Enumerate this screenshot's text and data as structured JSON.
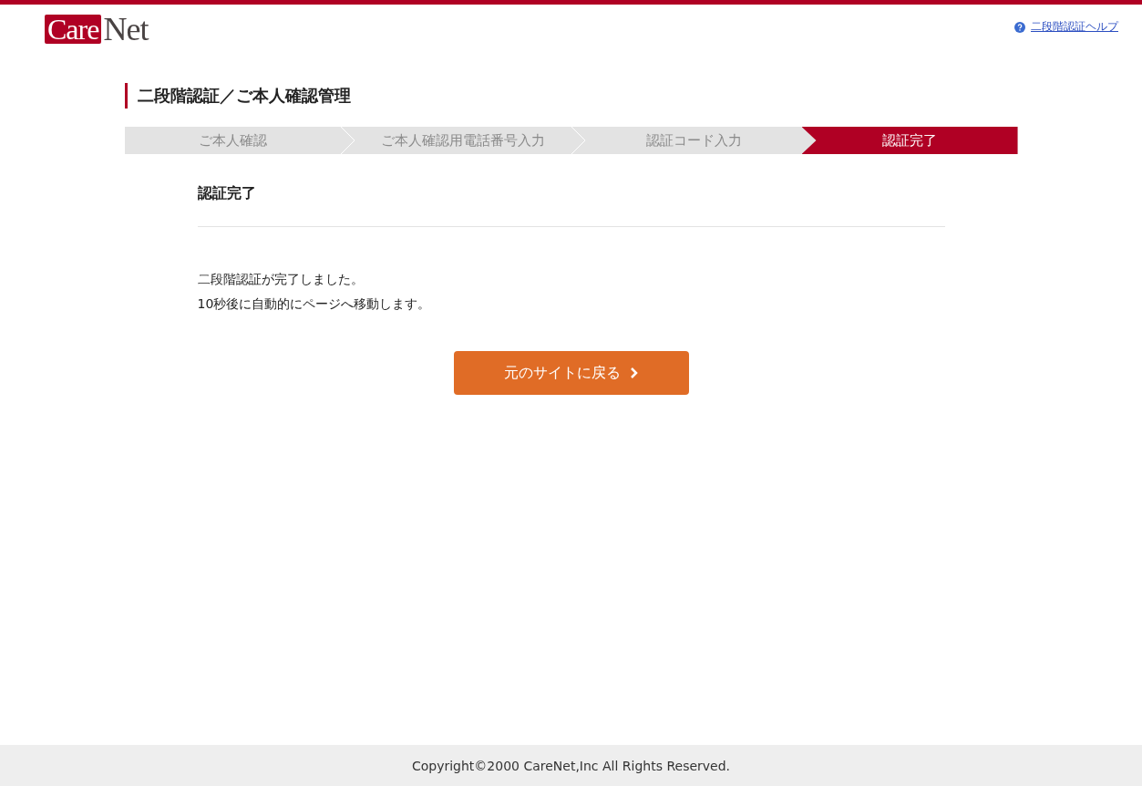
{
  "logo": {
    "part_1": "Care",
    "part_2": "Net"
  },
  "help_link": "二段階認証ヘルプ",
  "page_title": "二段階認証／ご本人確認管理",
  "steps": [
    {
      "label": "ご本人確認",
      "selected": false
    },
    {
      "label": "ご本人確認用電話番号入力",
      "selected": false
    },
    {
      "label": "認証コード入力",
      "selected": false
    },
    {
      "label": "認証完了",
      "selected": true
    }
  ],
  "section_title": "認証完了",
  "messages": [
    "二段階認証が完了しました。",
    "10秒後に自動的にページへ移動します。"
  ],
  "button": "元のサイトに戻る",
  "footer": "Copyright©2000 CareNet,Inc All Rights Reserved."
}
